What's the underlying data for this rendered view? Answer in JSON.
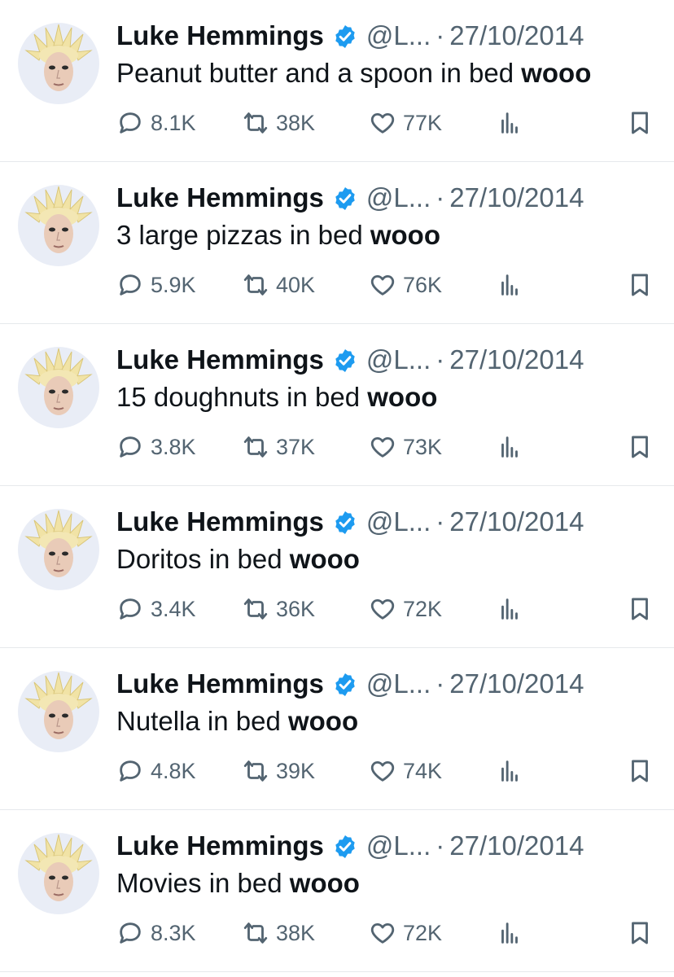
{
  "tweets": [
    {
      "name": "Luke Hemmings",
      "handle": "@L...",
      "separator": "·",
      "date": "27/10/2014",
      "text_main": "Peanut butter and a spoon in bed ",
      "text_emph": "wooo",
      "replies": "8.1K",
      "retweets": "38K",
      "likes": "77K"
    },
    {
      "name": "Luke Hemmings",
      "handle": "@L...",
      "separator": "·",
      "date": "27/10/2014",
      "text_main": "3 large pizzas in bed ",
      "text_emph": "wooo",
      "replies": "5.9K",
      "retweets": "40K",
      "likes": "76K"
    },
    {
      "name": "Luke Hemmings",
      "handle": "@L...",
      "separator": "·",
      "date": "27/10/2014",
      "text_main": "15 doughnuts in bed ",
      "text_emph": "wooo",
      "replies": "3.8K",
      "retweets": "37K",
      "likes": "73K"
    },
    {
      "name": "Luke Hemmings",
      "handle": "@L...",
      "separator": "·",
      "date": "27/10/2014",
      "text_main": "Doritos in bed ",
      "text_emph": "wooo",
      "replies": "3.4K",
      "retweets": "36K",
      "likes": "72K"
    },
    {
      "name": "Luke Hemmings",
      "handle": "@L...",
      "separator": "·",
      "date": "27/10/2014",
      "text_main": "Nutella in bed ",
      "text_emph": "wooo",
      "replies": "4.8K",
      "retweets": "39K",
      "likes": "74K"
    },
    {
      "name": "Luke Hemmings",
      "handle": "@L...",
      "separator": "·",
      "date": "27/10/2014",
      "text_main": "Movies in bed ",
      "text_emph": "wooo",
      "replies": "8.3K",
      "retweets": "38K",
      "likes": "72K"
    }
  ],
  "colors": {
    "verified_blue": "#1d9bf0",
    "muted_text": "#536471",
    "divider": "#e6e9ec"
  },
  "icons": {
    "reply": "reply-bubble-icon",
    "retweet": "retweet-icon",
    "like": "heart-icon",
    "views": "views-bar-chart-icon",
    "bookmark": "bookmark-icon",
    "verified": "verified-badge-icon"
  }
}
